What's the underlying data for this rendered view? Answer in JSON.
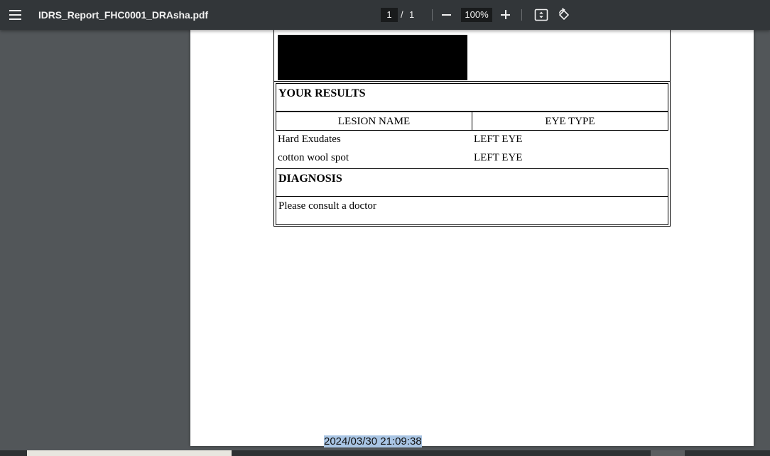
{
  "toolbar": {
    "file_name": "IDRS_Report_FHC0001_DRAsha.pdf",
    "current_page": "1",
    "page_separator": "/",
    "total_pages": "1",
    "zoom_level": "100%",
    "icons": [
      "menu-icon",
      "zoom-out-icon",
      "zoom-in-icon",
      "fit-to-page-icon",
      "rotate-icon"
    ]
  },
  "report": {
    "results_heading": "YOUR RESULTS",
    "columns": [
      "LESION NAME",
      "EYE TYPE"
    ],
    "rows": [
      {
        "lesion": "Hard Exudates",
        "eye": "LEFT EYE"
      },
      {
        "lesion": "cotton wool spot",
        "eye": "LEFT EYE"
      }
    ],
    "diagnosis_heading": "DIAGNOSIS",
    "diagnosis_text": "Please consult a doctor"
  },
  "overlay": {
    "timestamp": "2024/03/30 21:09:38"
  },
  "colors": {
    "toolbar_bg": "#323639",
    "viewer_bg": "#525659",
    "page_bg": "#ffffff",
    "selection_highlight": "#a9c5e4"
  }
}
